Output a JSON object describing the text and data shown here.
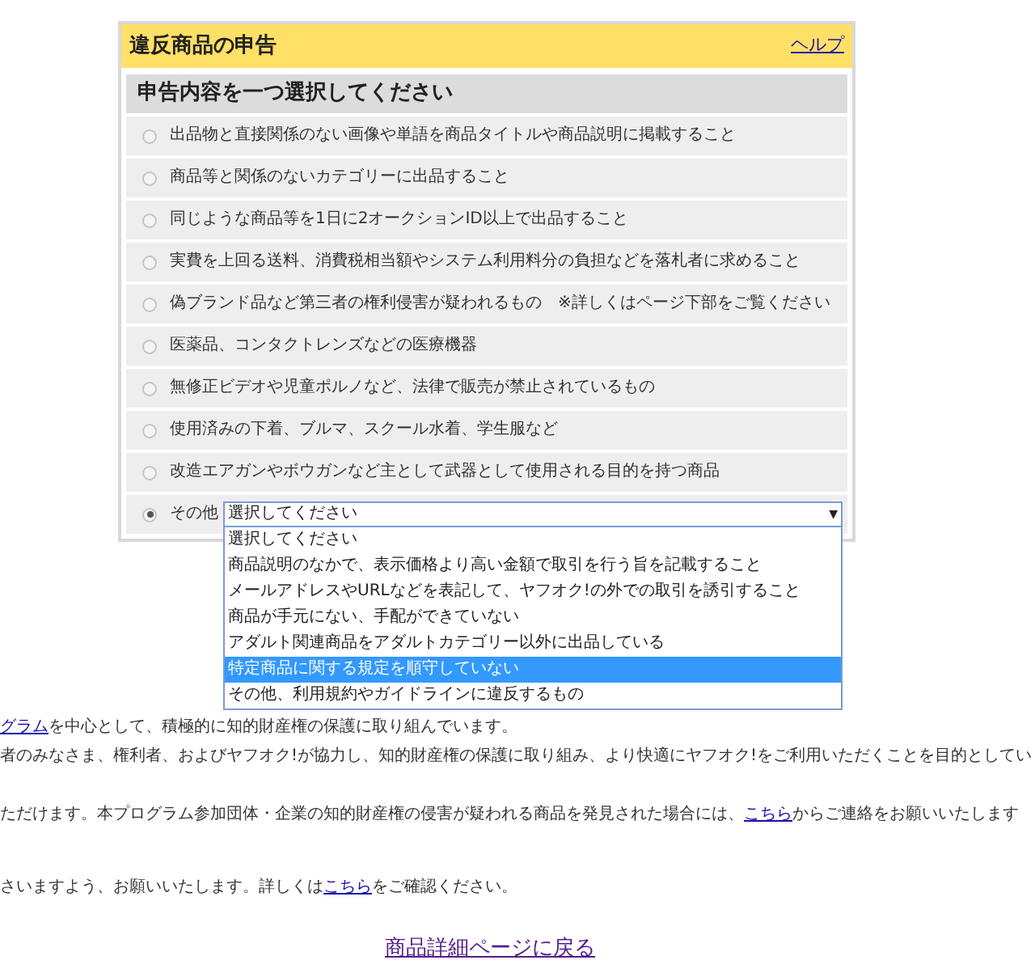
{
  "dialog": {
    "title": "違反商品の申告",
    "help_link": "ヘルプ"
  },
  "section_heading": "申告内容を一つ選択してください",
  "options": [
    {
      "kind": "radio",
      "label": "出品物と直接関係のない画像や単語を商品タイトルや商品説明に掲載すること",
      "selected": false
    },
    {
      "kind": "radio",
      "label": "商品等と関係のないカテゴリーに出品すること",
      "selected": false
    },
    {
      "kind": "radio",
      "label": "同じような商品等を1日に2オークションID以上で出品すること",
      "selected": false
    },
    {
      "kind": "radio",
      "label": "実費を上回る送料、消費税相当額やシステム利用料分の負担などを落札者に求めること",
      "selected": false
    },
    {
      "kind": "radio",
      "label": "偽ブランド品など第三者の権利侵害が疑われるもの　※詳しくはページ下部をご覧ください",
      "selected": false
    },
    {
      "kind": "radio",
      "label": "医薬品、コンタクトレンズなどの医療機器",
      "selected": false
    },
    {
      "kind": "radio",
      "label": "無修正ビデオや児童ポルノなど、法律で販売が禁止されているもの",
      "selected": false
    },
    {
      "kind": "radio",
      "label": "使用済みの下着、ブルマ、スクール水着、学生服など",
      "selected": false
    },
    {
      "kind": "radio",
      "label": "改造エアガンやボウガンなど主として武器として使用される目的を持つ商品",
      "selected": false
    },
    {
      "kind": "select",
      "label": "その他",
      "selected": true,
      "select": {
        "value": "選択してください",
        "arrow": "▼",
        "expanded": true,
        "options": [
          {
            "label": "選択してください",
            "highlighted": false
          },
          {
            "label": "商品説明のなかで、表示価格より高い金額で取引を行う旨を記載すること",
            "highlighted": false
          },
          {
            "label": "メールアドレスやURLなどを表記して、ヤフオク!の外での取引を誘引すること",
            "highlighted": false
          },
          {
            "label": "商品が手元にない、手配ができていない",
            "highlighted": false
          },
          {
            "label": "アダルト関連商品をアダルトカテゴリー以外に出品している",
            "highlighted": false
          },
          {
            "label": "特定商品に関する規定を順守していない",
            "highlighted": true
          },
          {
            "label": "その他、利用規約やガイドラインに違反するもの",
            "highlighted": false
          }
        ]
      }
    }
  ],
  "background_text": [
    [
      {
        "kind": "link",
        "text": "グラム"
      },
      {
        "kind": "text",
        "text": "を中心として、積極的に知的財産権の保護に取り組んでいます。"
      }
    ],
    [
      {
        "kind": "text",
        "text": "者のみなさま、権利者、およびヤフオク!が協力し、知的財産権の保護に取り組み、より快適にヤフオク!をご利用いただくことを目的としてい"
      }
    ],
    [
      {
        "kind": "text",
        "text": "ただけます。本プログラム参加団体・企業の知的財産権の侵害が疑われる商品を発見された場合には、"
      },
      {
        "kind": "link",
        "text": "こちら"
      },
      {
        "kind": "text",
        "text": "からご連絡をお願いいたします"
      }
    ],
    [
      {
        "kind": "text",
        "text": "さいますよう、お願いいたします。詳しくは"
      },
      {
        "kind": "link",
        "text": "こちら"
      },
      {
        "kind": "text",
        "text": "をご確認ください。"
      }
    ]
  ],
  "back_link": "商品詳細ページに戻る"
}
